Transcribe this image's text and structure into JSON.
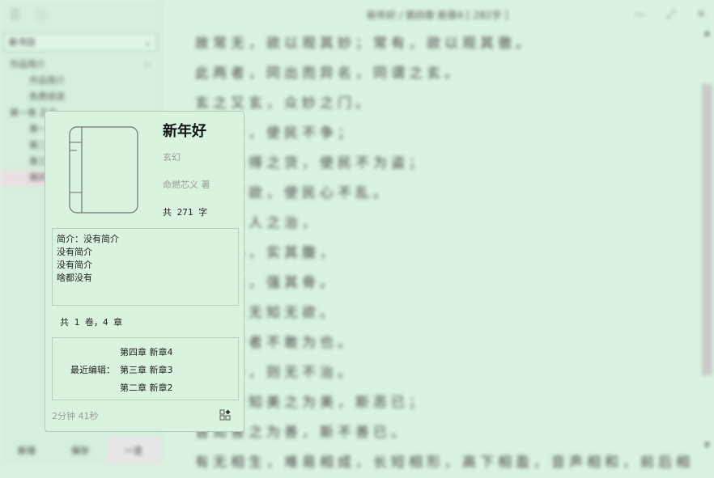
{
  "background": {
    "sidebar": {
      "search_label": "新书目",
      "tree": [
        {
          "label": "作品简介",
          "level": 1
        },
        {
          "label": "作品简介",
          "level": 2
        },
        {
          "label": "免费阅读",
          "level": 2
        },
        {
          "label": "第一卷 正文",
          "level": 1
        },
        {
          "label": "第一章",
          "level": 2
        },
        {
          "label": "第二章",
          "level": 2
        },
        {
          "label": "第三章",
          "level": 2
        },
        {
          "label": "第四章",
          "level": 2
        }
      ],
      "bottom_buttons": [
        "新增",
        "保存",
        "一览"
      ]
    },
    "window_title": "新年好 / 第四章 新章4 [ 282字 ]",
    "text_lines": [
      "故常无，欲以观其妙；常有，欲以观其徼。",
      "此两者，同出而异名，同谓之玄。",
      "玄之又玄，众妙之门。",
      "不尚贤，使民不争；",
      "不贵难得之货，使民不为盗；",
      "不见可欲，使民心不乱。",
      "是以圣人之治，",
      "虚其心，实其腹，",
      "弱其志，强其骨。",
      "常使民无知无欲。",
      "使夫智者不敢为也。",
      "为无为，则无不治。",
      "天下皆知美之为美，斯恶已；",
      "皆知善之为善，斯不善已。",
      "有无相生，难易相成，长短相形，高下相盈，音声相和，前后相随。"
    ]
  },
  "card": {
    "title": "新年好",
    "genre": "玄幻",
    "author": "命燃芯义 著",
    "word_count": "共 271 字",
    "intro_lines": [
      "简介：没有简介",
      "没有简介",
      "没有简介",
      "啥都没有"
    ],
    "volume_summary": "共 1 卷，4 章",
    "recent_label": "最近编辑：",
    "recent_items": [
      "第四章 新章4",
      "第三章 新章3",
      "第二章 新章2"
    ],
    "elapsed": "2分钟 41秒",
    "action_icon": "widgets-icon"
  }
}
